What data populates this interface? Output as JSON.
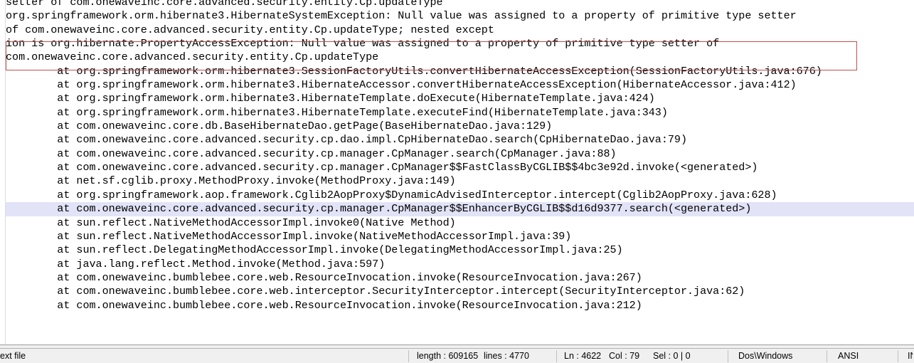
{
  "window": {
    "app": "Notepad++",
    "background_color": "#ffffff"
  },
  "editor": {
    "highlight_line_color": "#e2e3f7",
    "annotation_box_color": "#c0504d",
    "lines": [
      {
        "text": "setter of com.onewaveinc.core.advanced.security.entity.Cp.updateType",
        "highlight": false
      },
      {
        "text": "org.springframework.orm.hibernate3.HibernateSystemException: Null value was assigned to a property of primitive type setter",
        "highlight": false
      },
      {
        "text": "of com.onewaveinc.core.advanced.security.entity.Cp.updateType; nested except",
        "highlight": false
      },
      {
        "text": "ion is org.hibernate.PropertyAccessException: Null value was assigned to a property of primitive type setter of",
        "highlight": false
      },
      {
        "text": "com.onewaveinc.core.advanced.security.entity.Cp.updateType",
        "highlight": false
      },
      {
        "text": "        at org.springframework.orm.hibernate3.SessionFactoryUtils.convertHibernateAccessException(SessionFactoryUtils.java:676)",
        "highlight": false
      },
      {
        "text": "        at org.springframework.orm.hibernate3.HibernateAccessor.convertHibernateAccessException(HibernateAccessor.java:412)",
        "highlight": false
      },
      {
        "text": "        at org.springframework.orm.hibernate3.HibernateTemplate.doExecute(HibernateTemplate.java:424)",
        "highlight": false
      },
      {
        "text": "        at org.springframework.orm.hibernate3.HibernateTemplate.executeFind(HibernateTemplate.java:343)",
        "highlight": false
      },
      {
        "text": "        at com.onewaveinc.core.db.BaseHibernateDao.getPage(BaseHibernateDao.java:129)",
        "highlight": false
      },
      {
        "text": "        at com.onewaveinc.core.advanced.security.cp.dao.impl.CpHibernateDao.search(CpHibernateDao.java:79)",
        "highlight": false
      },
      {
        "text": "        at com.onewaveinc.core.advanced.security.cp.manager.CpManager.search(CpManager.java:88)",
        "highlight": false
      },
      {
        "text": "        at com.onewaveinc.core.advanced.security.cp.manager.CpManager$$FastClassByCGLIB$$4bc3e92d.invoke(<generated>)",
        "highlight": false
      },
      {
        "text": "        at net.sf.cglib.proxy.MethodProxy.invoke(MethodProxy.java:149)",
        "highlight": false
      },
      {
        "text": "        at org.springframework.aop.framework.Cglib2AopProxy$DynamicAdvisedInterceptor.intercept(Cglib2AopProxy.java:628)",
        "highlight": false
      },
      {
        "text": "        at com.onewaveinc.core.advanced.security.cp.manager.CpManager$$EnhancerByCGLIB$$d16d9377.search(<generated>)",
        "highlight": true
      },
      {
        "text": "        at sun.reflect.NativeMethodAccessorImpl.invoke0(Native Method)",
        "highlight": false
      },
      {
        "text": "        at sun.reflect.NativeMethodAccessorImpl.invoke(NativeMethodAccessorImpl.java:39)",
        "highlight": false
      },
      {
        "text": "        at sun.reflect.DelegatingMethodAccessorImpl.invoke(DelegatingMethodAccessorImpl.java:25)",
        "highlight": false
      },
      {
        "text": "        at java.lang.reflect.Method.invoke(Method.java:597)",
        "highlight": false
      },
      {
        "text": "        at com.onewaveinc.bumblebee.core.web.ResourceInvocation.invoke(ResourceInvocation.java:267)",
        "highlight": false
      },
      {
        "text": "        at com.onewaveinc.bumblebee.core.web.interceptor.SecurityInterceptor.intercept(SecurityInterceptor.java:62)",
        "highlight": false
      },
      {
        "text": "        at com.onewaveinc.bumblebee.core.web.ResourceInvocation.invoke(ResourceInvocation.java:212)",
        "highlight": false
      }
    ]
  },
  "statusbar": {
    "doc_type": "ext file",
    "length": "length : 609165",
    "lines": "lines : 4770",
    "ln": "Ln : 4622",
    "col": "Col : 79",
    "sel": "Sel : 0 | 0",
    "eol": "Dos\\Windows",
    "encoding": "ANSI",
    "insert_mode": "INS"
  }
}
